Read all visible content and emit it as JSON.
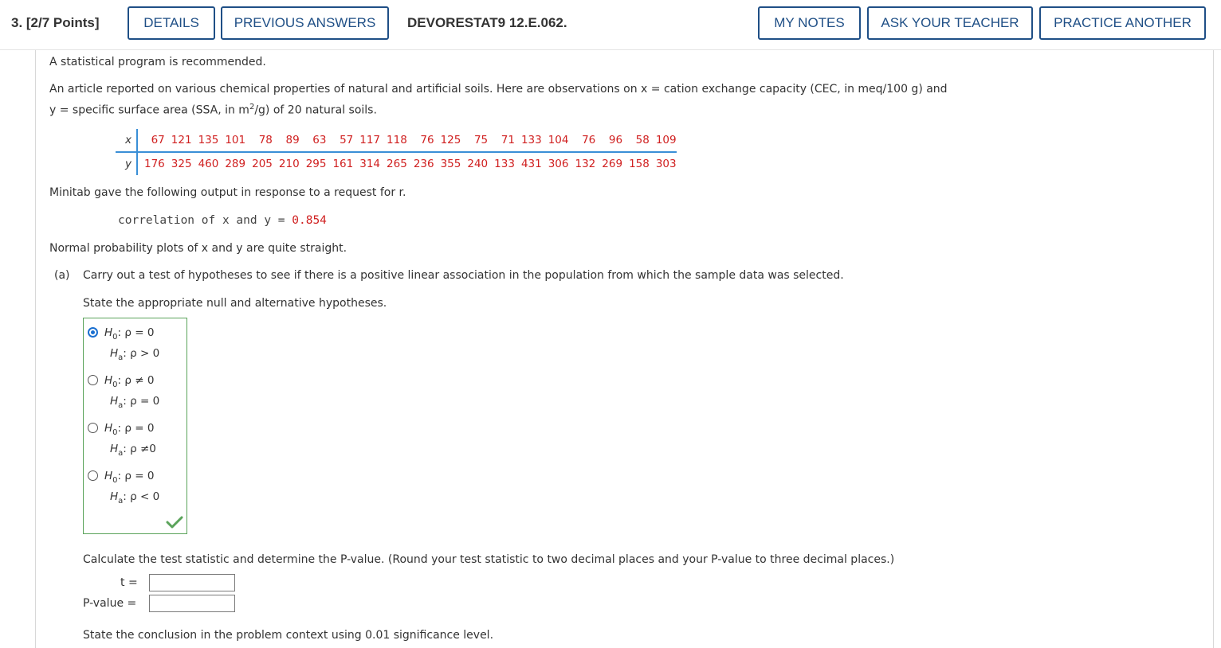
{
  "header": {
    "question_number": "3. [2/7 Points]",
    "details_label": "DETAILS",
    "previous_answers_label": "PREVIOUS ANSWERS",
    "question_code": "DEVORESTAT9 12.E.062.",
    "my_notes_label": "MY NOTES",
    "ask_teacher_label": "ASK YOUR TEACHER",
    "practice_another_label": "PRACTICE ANOTHER",
    "accent_color": "#1f4f86"
  },
  "problem": {
    "recommendation": "A statistical program is recommended.",
    "intro_line1": "An article reported on various chemical properties of natural and artificial soils. Here are observations on x = cation exchange capacity (CEC, in meq/100 g) and",
    "intro_line2_a": "y = specific surface area (SSA, in m",
    "intro_line2_sup": "2",
    "intro_line2_b": "/g) of 20 natural soils.",
    "table": {
      "x_label": "x",
      "y_label": "y",
      "x_values": [
        "67",
        "121",
        "135",
        "101",
        "78",
        "89",
        "63",
        "57",
        "117",
        "118",
        "76",
        "125",
        "75",
        "71",
        "133",
        "104",
        "76",
        "96",
        "58",
        "109"
      ],
      "y_values": [
        "176",
        "325",
        "460",
        "289",
        "205",
        "210",
        "295",
        "161",
        "314",
        "265",
        "236",
        "355",
        "240",
        "133",
        "431",
        "306",
        "132",
        "269",
        "158",
        "303"
      ]
    },
    "minitab_intro": "Minitab gave the following output in response to a request for r.",
    "correlation_text": "correlation of x and y = ",
    "correlation_value": "0.854",
    "normal_plots": "Normal probability plots of x and y are quite straight."
  },
  "part_a": {
    "label": "(a)",
    "prompt": "Carry out a test of hypotheses to see if there is a positive linear association in the population from which the sample data was selected.",
    "state_prompt": "State the appropriate null and alternative hypotheses.",
    "options": [
      {
        "h0": "H0: ρ = 0",
        "ha": "Ha: ρ > 0",
        "selected": true
      },
      {
        "h0": "H0: ρ ≠ 0",
        "ha": "Ha: ρ = 0",
        "selected": false
      },
      {
        "h0": "H0: ρ = 0",
        "ha": "Ha: ρ ≠0",
        "selected": false
      },
      {
        "h0": "H0: ρ = 0",
        "ha": "Ha: ρ < 0",
        "selected": false
      }
    ],
    "options_display": [
      {
        "h0_rel": ": ρ = 0",
        "ha_rel": ": ρ > 0"
      },
      {
        "h0_rel": ": ρ ≠ 0",
        "ha_rel": ": ρ = 0"
      },
      {
        "h0_rel": ": ρ = 0",
        "ha_rel": ": ρ ≠0"
      },
      {
        "h0_rel": ": ρ = 0",
        "ha_rel": ": ρ < 0"
      }
    ],
    "correct_icon": "checkmark-icon",
    "correct_color": "#5aa35a",
    "calc_prompt": "Calculate the test statistic and determine the P-value. (Round your test statistic to two decimal places and your P-value to three decimal places.)",
    "t_label": "t =",
    "t_value": "",
    "p_label": "P-value =",
    "p_value": "",
    "conclusion_prompt": "State the conclusion in the problem context using 0.01 significance level."
  }
}
